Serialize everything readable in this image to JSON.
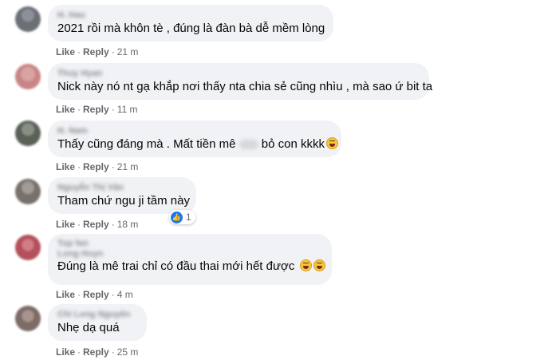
{
  "actions": {
    "like": "Like",
    "reply": "Reply",
    "separator": "·"
  },
  "comments": [
    {
      "author": "H. Hau",
      "text": "2021 rồi mà khôn tè , đúng là đàn bà dễ mềm lòng",
      "time": "21 m",
      "avatar_color": "#6b6f76"
    },
    {
      "author": "Thuy Hyan",
      "text": "Nick này nó nt gạ khắp nơi thấy nta chia sẻ cũng nhìu , mà sao ứ bit ta",
      "time": "11 m",
      "avatar_color": "#c98585"
    },
    {
      "author": "H. Nam",
      "text_before": "Thấy cũng đáng mà . Mất tiền mê",
      "text_after": "bỏ con kkkk",
      "emoji": "laughing-face",
      "time": "21 m",
      "avatar_color": "#5a6258"
    },
    {
      "author": "Nguyễn Thị Vân",
      "text": "Tham chứ ngu ji tầm này",
      "time": "18 m",
      "reaction_count": "1",
      "avatar_color": "#77716c"
    },
    {
      "author": "Top fan",
      "author_line2": "Long Huyn",
      "text": "Đúng là mê trai chỉ có đầu thai mới hết được",
      "emojis": [
        "grinning-squinting-face",
        "grinning-squinting-face"
      ],
      "time": "4 m",
      "avatar_color": "#b3505c"
    },
    {
      "author": "Chí Long Nguyên",
      "text": "Nhẹ dạ quá",
      "time": "25 m",
      "avatar_color": "#7d6b66"
    }
  ],
  "colors": {
    "bubble": "#f0f2f5",
    "text": "#050505",
    "meta": "#65676b",
    "like_blue": "#1877f2"
  }
}
